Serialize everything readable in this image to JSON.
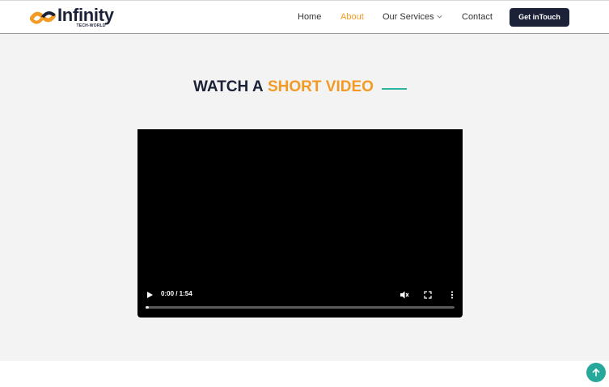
{
  "brand": {
    "name": "Infinity",
    "tagline": "TECH-WORLD",
    "colors": {
      "dark": "#1b2238",
      "orange": "#f39a24",
      "teal": "#2bb5a0"
    }
  },
  "nav": {
    "items": [
      {
        "label": "Home",
        "active": false
      },
      {
        "label": "About",
        "active": true
      },
      {
        "label": "Our Services",
        "active": false,
        "icon": "chevron-down-icon"
      },
      {
        "label": "Contact",
        "active": false
      }
    ],
    "cta_label": "Get inTouch"
  },
  "section": {
    "heading_dark": "WATCH A",
    "heading_accent": "SHORT VIDEO"
  },
  "video": {
    "time_display": "0:00 / 1:54",
    "progress": 0.01,
    "controls": [
      "play-icon",
      "mute-icon",
      "fullscreen-icon",
      "more-options-icon"
    ]
  },
  "scroll_top": {
    "icon": "arrow-up-icon"
  }
}
